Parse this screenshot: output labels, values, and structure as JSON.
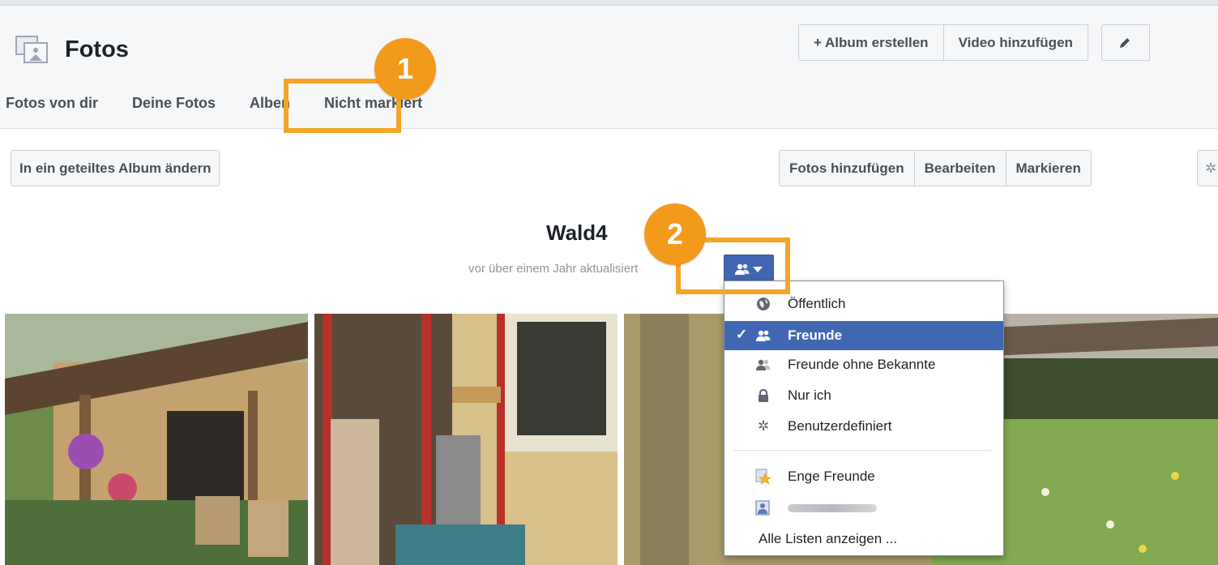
{
  "header": {
    "title": "Fotos",
    "actions": {
      "create_album": "+ Album erstellen",
      "add_video": "Video hinzufügen"
    }
  },
  "tabs": [
    {
      "label": "Fotos von dir"
    },
    {
      "label": "Deine Fotos"
    },
    {
      "label": "Alben"
    },
    {
      "label": "Nicht markiert"
    }
  ],
  "toolbar": {
    "shared_album": "In ein geteiltes Album ändern",
    "add_photos": "Fotos hinzufügen",
    "edit": "Bearbeiten",
    "tag": "Markieren"
  },
  "album": {
    "title": "Wald4",
    "meta": "vor über einem Jahr aktualisiert"
  },
  "audience_menu": {
    "items": [
      {
        "label": "Öffentlich",
        "icon": "globe-icon",
        "selected": false
      },
      {
        "label": "Freunde",
        "icon": "friends-icon",
        "selected": true
      },
      {
        "label": "Freunde ohne Bekannte",
        "icon": "friends-except-acquaintances-icon",
        "selected": false
      },
      {
        "label": "Nur ich",
        "icon": "lock-icon",
        "selected": false
      },
      {
        "label": "Benutzerdefiniert",
        "icon": "gear-icon",
        "selected": false
      }
    ],
    "lists": [
      {
        "label": "Enge Freunde",
        "icon": "star-friends-icon"
      },
      {
        "label": "",
        "icon": "list-icon"
      }
    ],
    "show_all": "Alle Listen anzeigen ..."
  },
  "callouts": [
    {
      "number": "1"
    },
    {
      "number": "2"
    }
  ]
}
